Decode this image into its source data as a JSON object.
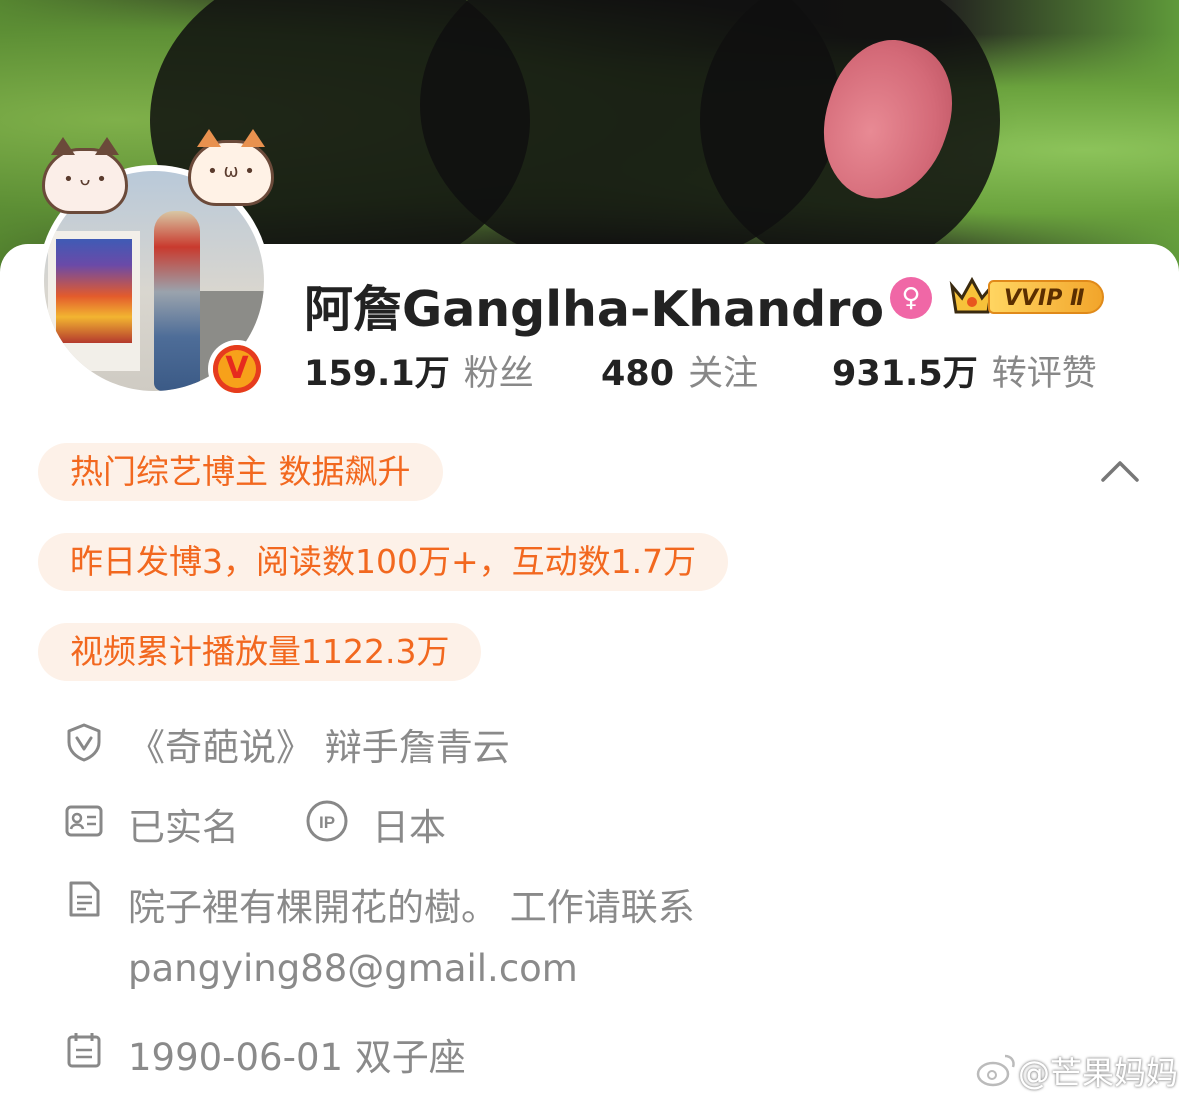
{
  "profile": {
    "name": "阿詹Ganglha-Khandro",
    "gender_symbol": "♀",
    "verified_symbol": "V",
    "vip_label": "VVIP Ⅱ"
  },
  "stats": {
    "fans_value": "159.1万",
    "fans_label": "粉丝",
    "following_value": "480",
    "following_label": "关注",
    "likes_value": "931.5万",
    "likes_label": "转评赞"
  },
  "highlights": [
    "热门综艺博主 数据飙升",
    "昨日发博3，阅读数100万+，互动数1.7万",
    "视频累计播放量1122.3万"
  ],
  "info": {
    "verification": "《奇葩说》 辩手詹青云",
    "real_name": "已实名",
    "ip_label": "IP",
    "ip_location": "日本",
    "bio_line1": "院子裡有棵開花的樹。 工作请联系",
    "bio_line2": "pangying88@gmail.com",
    "birthday": "1990-06-01 双子座"
  },
  "watermark": "@芒果妈妈",
  "colors": {
    "accent_orange": "#f2681f",
    "pill_bg": "#fdf1e8",
    "gender_pink": "#f067a6",
    "text_gray": "#888888"
  },
  "icons": [
    "cat-face-icon",
    "shield-v-icon",
    "id-card-icon",
    "ip-icon",
    "document-icon",
    "calendar-icon",
    "chevron-up-icon",
    "crown-icon",
    "weibo-logo-icon"
  ]
}
